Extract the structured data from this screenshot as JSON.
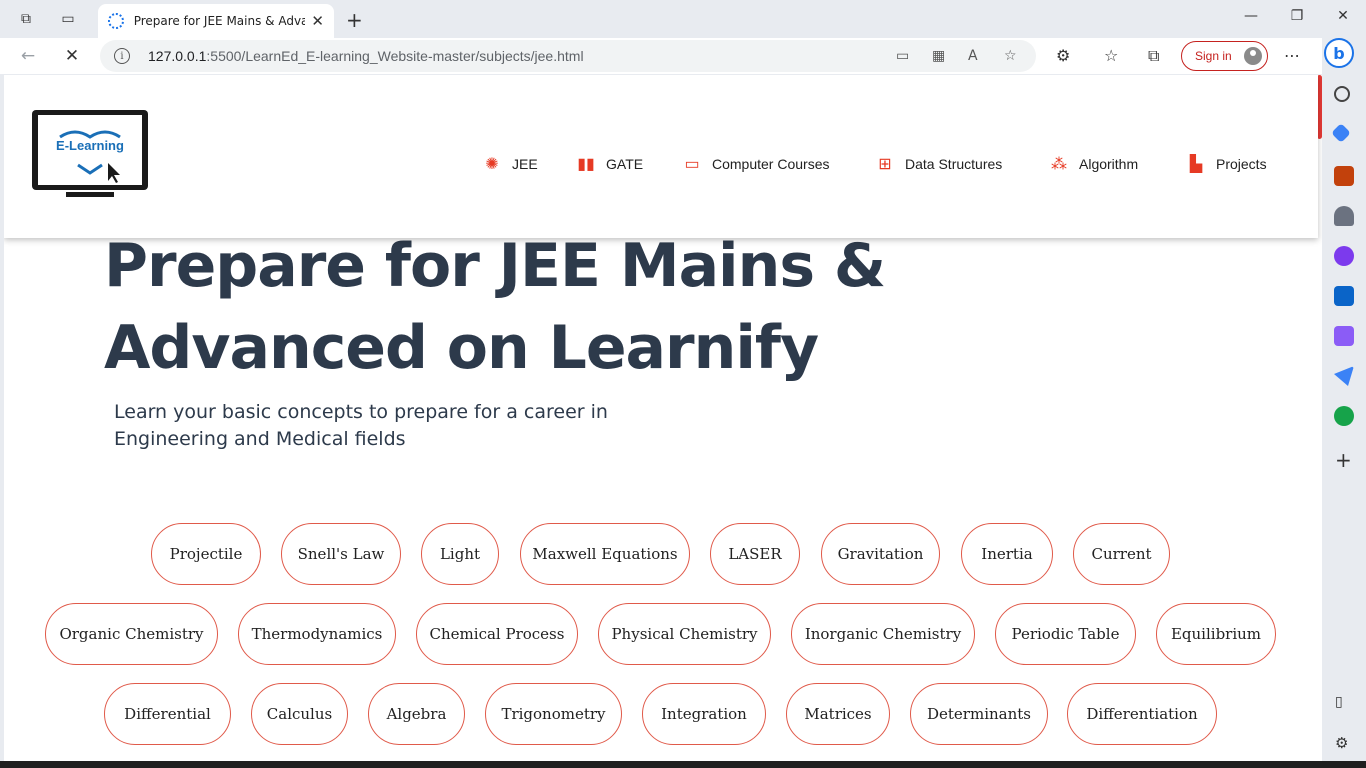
{
  "browser": {
    "tab_title": "Prepare for JEE Mains & Advanced",
    "url_host": "127.0.0.1",
    "url_rest": ":5500/LearnEd_E-learning_Website-master/subjects/jee.html",
    "sign_in": "Sign in",
    "bing_label": "b"
  },
  "site": {
    "logo_text": "E-Learning",
    "nav": [
      {
        "label": "JEE",
        "icon": "atom-icon"
      },
      {
        "label": "GATE",
        "icon": "book-icon"
      },
      {
        "label": "Computer Courses",
        "icon": "laptop-icon"
      },
      {
        "label": "Data Structures",
        "icon": "sitemap-icon"
      },
      {
        "label": "Algorithm",
        "icon": "nodes-icon"
      },
      {
        "label": "Projects",
        "icon": "grid-icon"
      }
    ],
    "hero_title": "Prepare for JEE Mains & Advanced on Learnify",
    "hero_subtitle": "Learn your basic concepts to prepare for a career in Engineering and Medical fields"
  },
  "topics": {
    "row1": [
      "Projectile",
      "Snell's Law",
      "Light",
      "Maxwell Equations",
      "LASER",
      "Gravitation",
      "Inertia",
      "Current"
    ],
    "row2": [
      "Organic Chemistry",
      "Thermodynamics",
      "Chemical Process",
      "Physical Chemistry",
      "Inorganic Chemistry",
      "Periodic Table",
      "Equilibrium"
    ],
    "row3": [
      "Differential",
      "Calculus",
      "Algebra",
      "Trigonometry",
      "Integration",
      "Matrices",
      "Determinants",
      "Differentiation"
    ]
  },
  "colors": {
    "accent": "#e63a24",
    "heading": "#2d3a4b",
    "pill_border": "#e05a4a"
  }
}
